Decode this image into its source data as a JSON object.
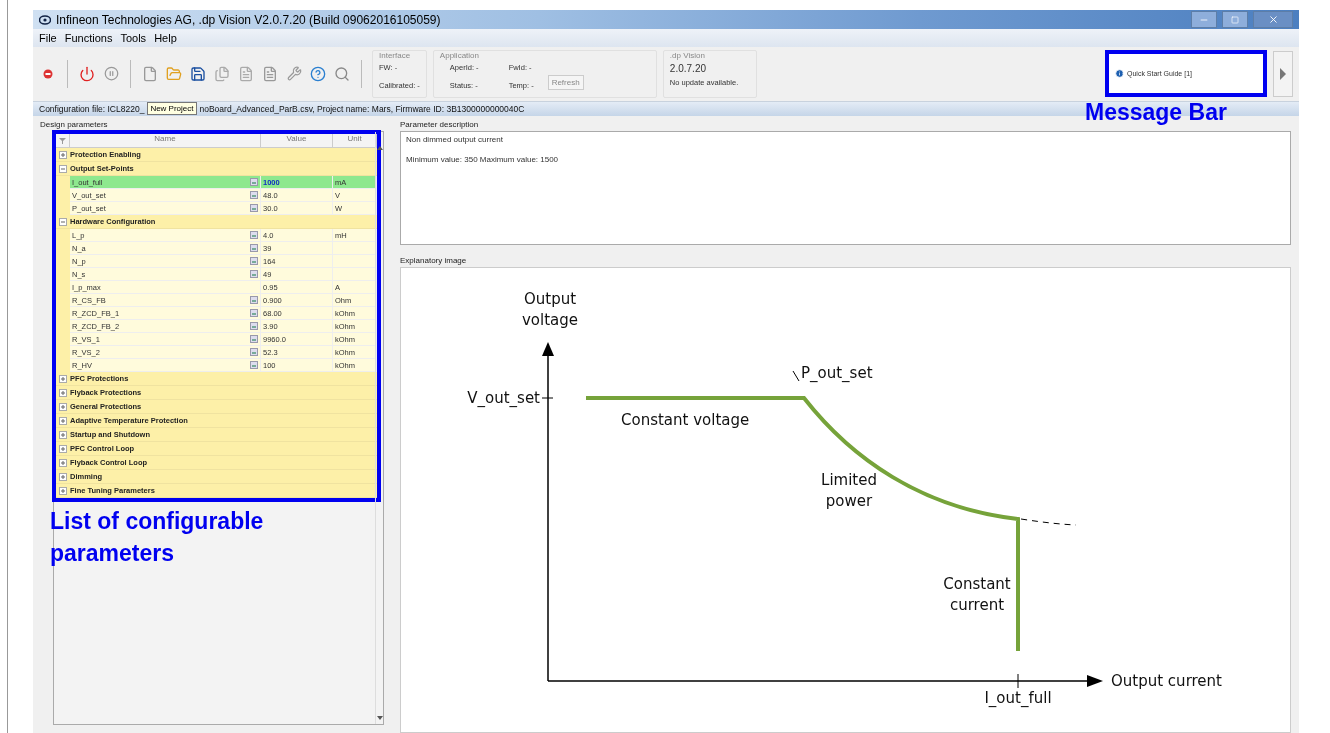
{
  "window": {
    "title": "Infineon Technologies AG, .dp Vision V2.0.7.20 (Build 09062016105059)"
  },
  "menu": [
    "File",
    "Functions",
    "Tools",
    "Help"
  ],
  "interface": {
    "title": "Interface",
    "fields": [
      "FW: -",
      "Calibrated: -"
    ]
  },
  "application": {
    "title": "Application",
    "fields": [
      "AperId: -",
      "FwId: -",
      "Status: -",
      "Temp: -"
    ],
    "button": "Refresh"
  },
  "dp_vision": {
    "title": ".dp Vision",
    "version": "2.0.7.20",
    "status": "No update available."
  },
  "message_bar": {
    "items": [
      "Quick Start Guide [1]"
    ]
  },
  "tooltip": "New Project",
  "config_bar": {
    "text_before": "Configuration file: ICL8220_",
    "text_after": "noBoard_Advanced_ParB.csv, Project name: Mars, Firmware ID: 3B1300000000040C"
  },
  "design_parameters": {
    "title": "Design parameters",
    "columns": [
      "Name",
      "Value",
      "Unit"
    ],
    "groups": [
      {
        "name": "Protection Enabling",
        "expanded": false
      },
      {
        "name": "Output Set-Points",
        "expanded": true,
        "children": [
          {
            "name": "I_out_full",
            "value": "1000",
            "unit": "mA",
            "editable": true,
            "selected": true
          },
          {
            "name": "V_out_set",
            "value": "48.0",
            "unit": "V",
            "editable": true,
            "selected": false
          },
          {
            "name": "P_out_set",
            "value": "30.0",
            "unit": "W",
            "editable": true,
            "selected": false
          }
        ]
      },
      {
        "name": "Hardware Configuration",
        "expanded": true,
        "children": [
          {
            "name": "L_p",
            "value": "4.0",
            "unit": "mH",
            "editable": true,
            "selected": false
          },
          {
            "name": "N_a",
            "value": "39",
            "editable": true,
            "selected": false
          },
          {
            "name": "N_p",
            "value": "164",
            "editable": true,
            "selected": false
          },
          {
            "name": "N_s",
            "value": "49",
            "editable": true,
            "selected": false
          },
          {
            "name": "I_p_max",
            "value": "0.95",
            "unit": "A",
            "editable": false,
            "selected": false
          },
          {
            "name": "R_CS_FB",
            "value": "0.900",
            "unit": "Ohm",
            "editable": true,
            "selected": false
          },
          {
            "name": "R_ZCD_FB_1",
            "value": "68.00",
            "unit": "kOhm",
            "editable": true,
            "selected": false
          },
          {
            "name": "R_ZCD_FB_2",
            "value": "3.90",
            "unit": "kOhm",
            "editable": true,
            "selected": false
          },
          {
            "name": "R_VS_1",
            "value": "9960.0",
            "unit": "kOhm",
            "editable": true,
            "selected": false
          },
          {
            "name": "R_VS_2",
            "value": "52.3",
            "unit": "kOhm",
            "editable": true,
            "selected": false
          },
          {
            "name": "R_HV",
            "value": "100",
            "unit": "kOhm",
            "editable": true,
            "selected": false
          }
        ]
      },
      {
        "name": "PFC Protections",
        "expanded": false
      },
      {
        "name": "Flyback Protections",
        "expanded": false
      },
      {
        "name": "General Protections",
        "expanded": false
      },
      {
        "name": "Adaptive Temperature Protection",
        "expanded": false
      },
      {
        "name": "Startup and Shutdown",
        "expanded": false
      },
      {
        "name": "PFC Control Loop",
        "expanded": false
      },
      {
        "name": "Flyback Control Loop",
        "expanded": false
      },
      {
        "name": "Dimming",
        "expanded": false
      },
      {
        "name": "Fine Tuning Parameters",
        "expanded": false
      }
    ]
  },
  "parameter_description": {
    "title": "Parameter description",
    "lines": [
      "Non dimmed output current",
      "Minimum value: 350 Maximum value: 1500"
    ]
  },
  "explanatory_image": {
    "title": "Explanatory image",
    "labels": {
      "y_axis": [
        "Output",
        "voltage"
      ],
      "v_out_set": "V_out_set",
      "p_out_set": "P_out_set",
      "constant_voltage": "Constant voltage",
      "limited_power": [
        "Limited",
        "power"
      ],
      "constant_current": [
        "Constant",
        "current"
      ],
      "i_out_full": "I_out_full",
      "x_axis": "Output current"
    }
  },
  "annotations": {
    "message_bar": "Message Bar",
    "parameter_list": [
      "List of configurable",
      "parameters"
    ]
  }
}
